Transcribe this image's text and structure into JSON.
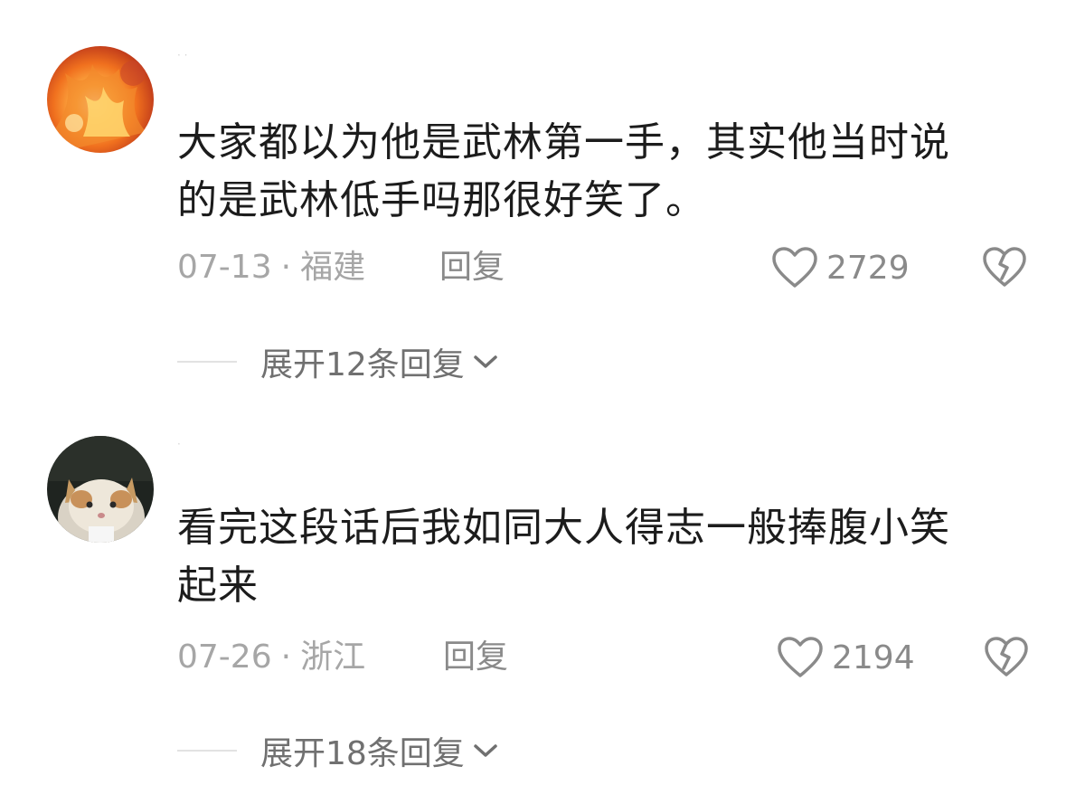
{
  "comments": [
    {
      "avatar_icon": "flame-avatar-icon",
      "username": "· ·",
      "text_line1": "大家都以为他是武林第一手，其实他当时说",
      "text_line2": "的是武林低手吗那很好笑了。",
      "date": "07-13",
      "separator": "·",
      "location": "福建",
      "reply_label": "回复",
      "like_icon": "heart-outline-icon",
      "like_count": "2729",
      "dislike_icon": "broken-heart-icon",
      "expand_label": "展开12条回复",
      "expand_icon": "chevron-down-icon"
    },
    {
      "avatar_icon": "cat-avatar-icon",
      "username": "·",
      "text_line1": "看完这段话后我如同大人得志一般捧腹小笑",
      "text_line2": "起来",
      "date": "07-26",
      "separator": "·",
      "location": "浙江",
      "reply_label": "回复",
      "like_icon": "heart-outline-icon",
      "like_count": "2194",
      "dislike_icon": "broken-heart-icon",
      "expand_label": "展开18条回复",
      "expand_icon": "chevron-down-icon"
    }
  ],
  "colors": {
    "text": "#1c1c1c",
    "meta": "#a6a6a6",
    "action": "#8a8a8a",
    "expand": "#707070",
    "divider": "#e2e2e2"
  }
}
